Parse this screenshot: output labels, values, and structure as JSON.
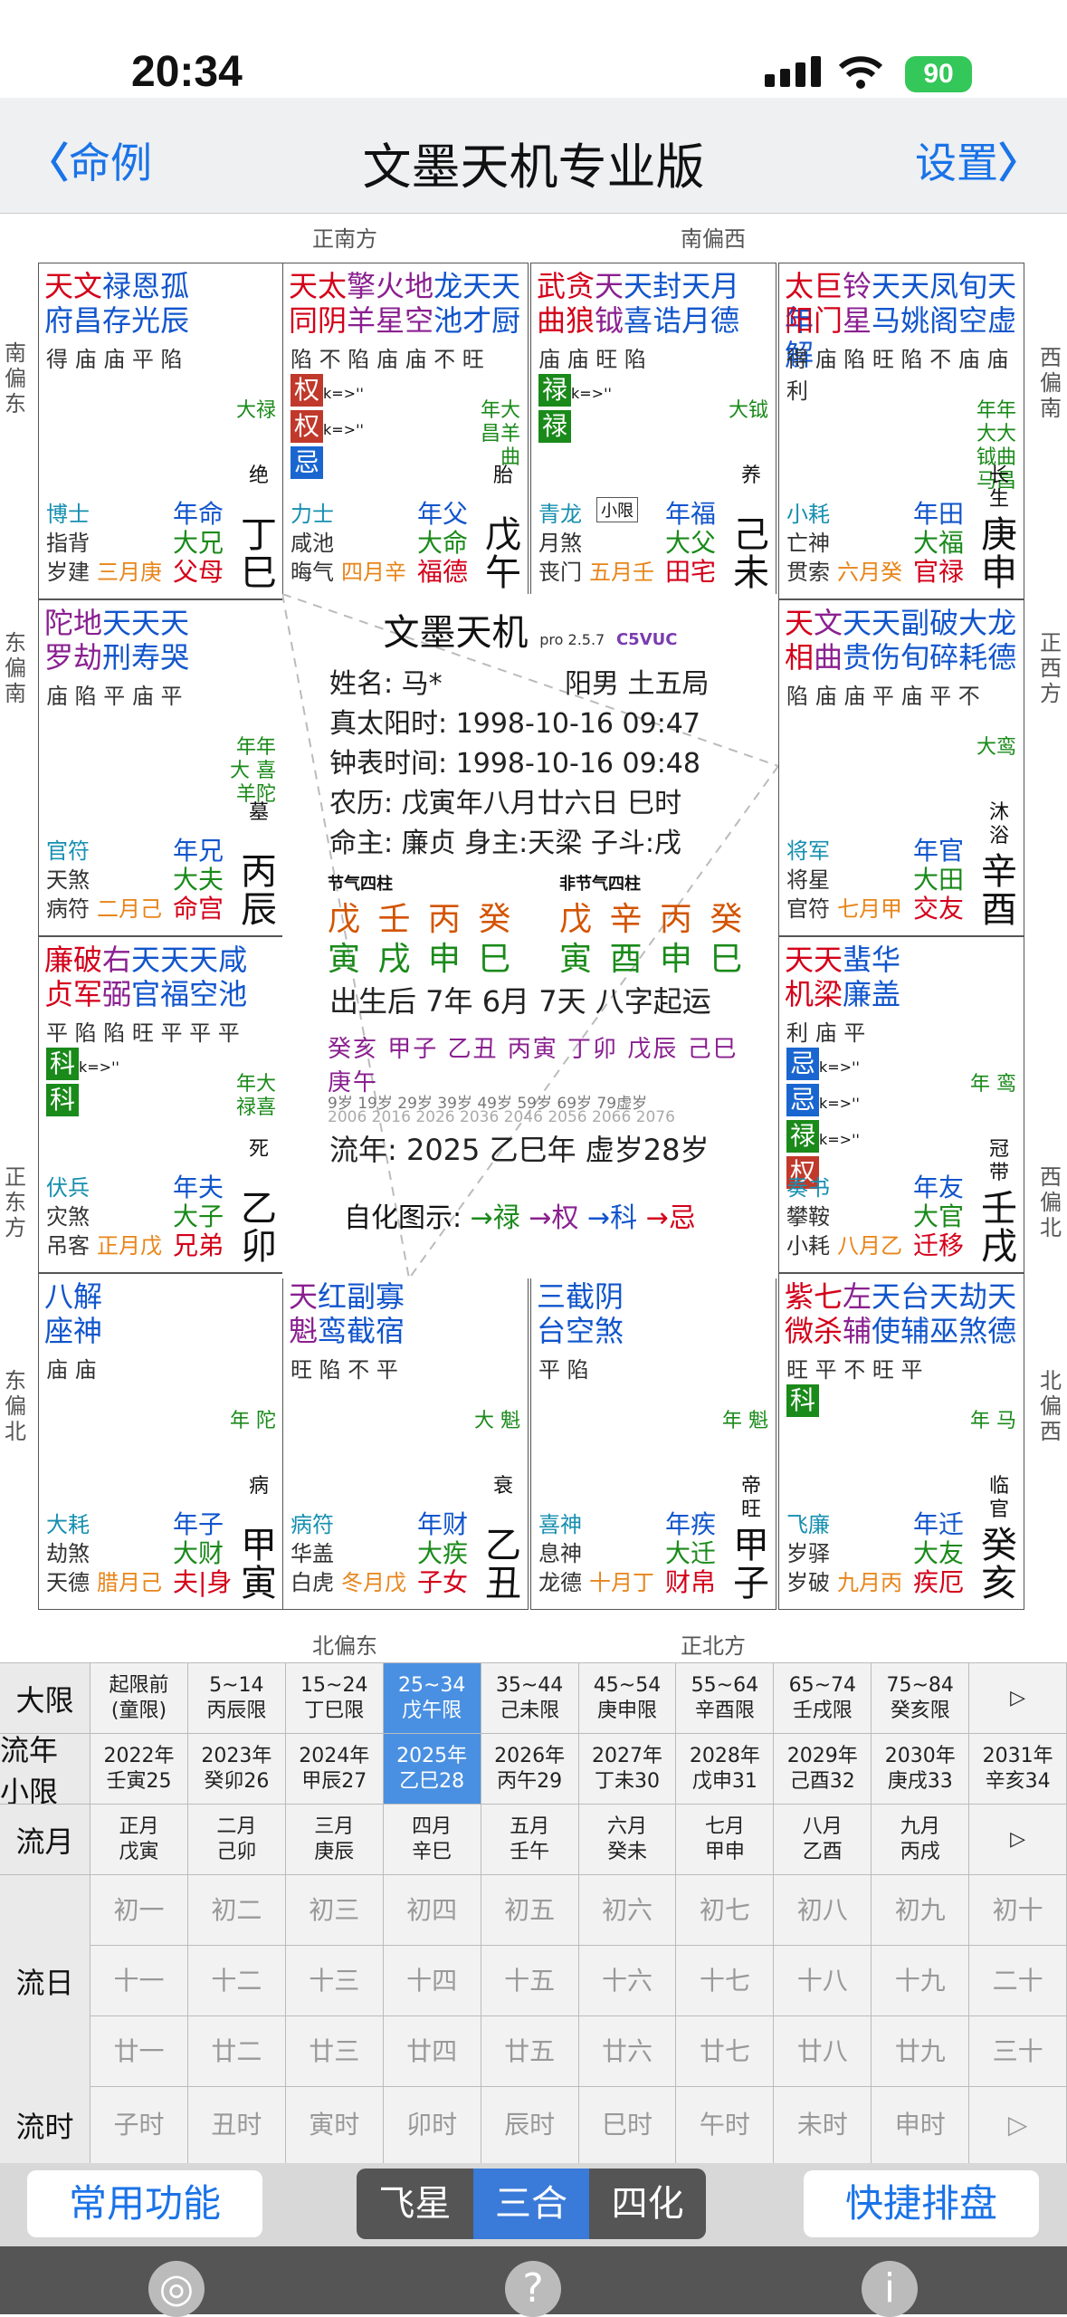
{
  "status": {
    "time": "20:34",
    "battery": "90"
  },
  "nav": {
    "back": "命例",
    "title": "文墨天机专业版",
    "settings": "设置"
  },
  "chart": {
    "dirs": {
      "top_left": "正南方",
      "top_right": "南偏西",
      "bottom_left": "北偏东",
      "bottom_right": "正北方",
      "l1": "南偏东",
      "l2": "东偏南",
      "l3": "正东方",
      "l4": "东偏北",
      "r1": "西偏南",
      "r2": "正西方",
      "r3": "西偏北",
      "r4": "北偏西"
    },
    "cells": [
      {
        "id": "si",
        "stars": [
          [
            "天",
            "red"
          ],
          [
            "文",
            "red"
          ],
          [
            "禄",
            "blue"
          ],
          [
            "恩",
            "blue"
          ],
          [
            "孤",
            "blue"
          ]
        ],
        "stars2": [
          [
            "府",
            "blue"
          ],
          [
            "昌",
            "blue"
          ],
          [
            "存",
            "blue"
          ],
          [
            "光",
            "blue"
          ],
          [
            "辰",
            "blue"
          ]
        ],
        "bright": "得 庙 庙 平 陷",
        "xiao": "大禄",
        "god1": "博士",
        "god2": "指背",
        "god3": "岁建",
        "month": "三月庚",
        "palace1": "年命",
        "palace2": "大兄",
        "palace3": "父母",
        "stage": "绝",
        "gan": "丁",
        "zhi": "巳"
      },
      {
        "id": "wu",
        "stars": [
          [
            "天",
            "red"
          ],
          [
            "太",
            "red"
          ],
          [
            "擎",
            "purple"
          ],
          [
            "火",
            "purple"
          ],
          [
            "地",
            "purple"
          ],
          [
            "龙",
            "blue"
          ],
          [
            "天",
            "blue"
          ],
          [
            "天",
            "blue"
          ]
        ],
        "stars2": [
          [
            "同",
            "red"
          ],
          [
            "阴",
            "red"
          ],
          [
            "羊",
            "purple"
          ],
          [
            "星",
            "purple"
          ],
          [
            "空",
            "purple"
          ],
          [
            "池",
            "blue"
          ],
          [
            "才",
            "blue"
          ],
          [
            "厨",
            "blue"
          ]
        ],
        "bright": "陷 不 陷 庙 庙 不 旺",
        "hua": [
          "权",
          "权",
          "忌"
        ],
        "xiao": "年大 昌羊曲",
        "god1": "力士",
        "god2": "咸池",
        "god3": "晦气",
        "month": "四月辛",
        "palace1": "年父",
        "palace2": "大命",
        "palace3": "福德",
        "stage": "胎",
        "gan": "戊",
        "zhi": "午"
      },
      {
        "id": "wei",
        "stars": [
          [
            "武",
            "red"
          ],
          [
            "贪",
            "red"
          ],
          [
            "天",
            "purple"
          ],
          [
            "天",
            "blue"
          ],
          [
            "封",
            "blue"
          ],
          [
            "天",
            "blue"
          ],
          [
            "月",
            "blue"
          ]
        ],
        "stars2": [
          [
            "曲",
            "red"
          ],
          [
            "狼",
            "red"
          ],
          [
            "钺",
            "purple"
          ],
          [
            "喜",
            "blue"
          ],
          [
            "诰",
            "blue"
          ],
          [
            "月",
            "blue"
          ],
          [
            "德",
            "blue"
          ]
        ],
        "bright": "庙 庙 旺 陷",
        "hua": [
          "禄",
          "禄"
        ],
        "xiao": "大钺",
        "god1": "青龙",
        "god2": "月煞",
        "god3": "丧门",
        "month": "五月壬",
        "palace1": "年福",
        "palace2": "大父",
        "palace3": "田宅",
        "stage": "养",
        "gan": "己",
        "zhi": "未",
        "tag": "小限"
      },
      {
        "id": "shen",
        "stars": [
          [
            "太",
            "red"
          ],
          [
            "巨",
            "red"
          ],
          [
            "铃",
            "purple"
          ],
          [
            "天",
            "blue"
          ],
          [
            "天",
            "blue"
          ],
          [
            "凤",
            "blue"
          ],
          [
            "旬",
            "blue"
          ],
          [
            "天",
            "blue"
          ],
          [
            "年",
            "blue"
          ]
        ],
        "stars2": [
          [
            "阳",
            "red"
          ],
          [
            "门",
            "red"
          ],
          [
            "星",
            "purple"
          ],
          [
            "马",
            "blue"
          ],
          [
            "姚",
            "blue"
          ],
          [
            "阁",
            "blue"
          ],
          [
            "空",
            "blue"
          ],
          [
            "虚",
            "blue"
          ],
          [
            "解",
            "blue"
          ]
        ],
        "bright": "得 庙 陷 旺 陷 不 庙 庙 利",
        "xiao": "年年大大 钺曲马昌",
        "god1": "小耗",
        "god2": "亡神",
        "god3": "贯索",
        "month": "六月癸",
        "palace1": "年田",
        "palace2": "大福",
        "palace3": "官禄",
        "stage": "长生",
        "gan": "庚",
        "zhi": "申"
      },
      {
        "id": "chen",
        "stars": [
          [
            "陀",
            "purple"
          ],
          [
            "地",
            "purple"
          ],
          [
            "天",
            "blue"
          ],
          [
            "天",
            "blue"
          ],
          [
            "天",
            "blue"
          ]
        ],
        "stars2": [
          [
            "罗",
            "purple"
          ],
          [
            "劫",
            "purple"
          ],
          [
            "刑",
            "blue"
          ],
          [
            "寿",
            "blue"
          ],
          [
            "哭",
            "blue"
          ]
        ],
        "bright": "庙 陷 平 庙 平",
        "xiao": "年年大 喜羊陀",
        "god1": "官符",
        "god2": "天煞",
        "god3": "病符",
        "month": "二月己",
        "palace1": "年兄",
        "palace2": "大夫",
        "palace3": "命宫",
        "stage": "墓",
        "gan": "丙",
        "zhi": "辰"
      },
      {
        "id": "you",
        "stars": [
          [
            "天",
            "red"
          ],
          [
            "文",
            "purple"
          ],
          [
            "天",
            "blue"
          ],
          [
            "天",
            "blue"
          ],
          [
            "副",
            "blue"
          ],
          [
            "破",
            "blue"
          ],
          [
            "大",
            "blue"
          ],
          [
            "龙",
            "blue"
          ]
        ],
        "stars2": [
          [
            "相",
            "red"
          ],
          [
            "曲",
            "purple"
          ],
          [
            "贵",
            "blue"
          ],
          [
            "伤",
            "blue"
          ],
          [
            "旬",
            "blue"
          ],
          [
            "碎",
            "blue"
          ],
          [
            "耗",
            "blue"
          ],
          [
            "德",
            "blue"
          ]
        ],
        "bright": "陷 庙 庙 平 庙 平 不",
        "xiao": "大鸾",
        "god1": "将军",
        "god2": "将星",
        "god3": "官符",
        "month": "七月甲",
        "palace1": "年官",
        "palace2": "大田",
        "palace3": "交友",
        "stage": "沐浴",
        "gan": "辛",
        "zhi": "酉"
      },
      {
        "id": "mao",
        "stars": [
          [
            "廉",
            "red"
          ],
          [
            "破",
            "red"
          ],
          [
            "右",
            "purple"
          ],
          [
            "天",
            "blue"
          ],
          [
            "天",
            "blue"
          ],
          [
            "天",
            "blue"
          ],
          [
            "咸",
            "blue"
          ]
        ],
        "stars2": [
          [
            "贞",
            "red"
          ],
          [
            "军",
            "red"
          ],
          [
            "弼",
            "purple"
          ],
          [
            "官",
            "blue"
          ],
          [
            "福",
            "blue"
          ],
          [
            "空",
            "blue"
          ],
          [
            "池",
            "blue"
          ]
        ],
        "bright": "平 陷 陷 旺 平 平 平",
        "hua": [
          "科",
          "科"
        ],
        "xiao": "年大 禄喜",
        "god1": "伏兵",
        "god2": "灾煞",
        "god3": "吊客",
        "month": "正月戊",
        "palace1": "年夫",
        "palace2": "大子",
        "palace3": "兄弟",
        "stage": "死",
        "gan": "乙",
        "zhi": "卯"
      },
      {
        "id": "xu",
        "stars": [
          [
            "天",
            "red"
          ],
          [
            "天",
            "red"
          ],
          [
            "蜚",
            "blue"
          ],
          [
            "华",
            "blue"
          ]
        ],
        "stars2": [
          [
            "机",
            "red"
          ],
          [
            "梁",
            "red"
          ],
          [
            "廉",
            "blue"
          ],
          [
            "盖",
            "blue"
          ]
        ],
        "bright": "利 庙 平",
        "hua": [
          "忌",
          "忌",
          "禄",
          "权"
        ],
        "xiao": "年 鸾",
        "god1": "奏书",
        "god2": "攀鞍",
        "god3": "小耗",
        "month": "八月乙",
        "palace1": "年友",
        "palace2": "大官",
        "palace3": "迁移",
        "stage": "冠带",
        "gan": "壬",
        "zhi": "戌"
      },
      {
        "id": "yin",
        "stars": [
          [
            "八",
            "blue"
          ],
          [
            "解",
            "blue"
          ]
        ],
        "stars2": [
          [
            "座",
            "blue"
          ],
          [
            "神",
            "blue"
          ]
        ],
        "bright": "庙 庙",
        "xiao": "年 陀",
        "god1": "大耗",
        "god2": "劫煞",
        "god3": "天德",
        "month": "腊月己",
        "palace1": "年子",
        "palace2": "大财",
        "palace3": "夫|身",
        "stage": "病",
        "gan": "甲",
        "zhi": "寅"
      },
      {
        "id": "chou",
        "stars": [
          [
            "天",
            "purple"
          ],
          [
            "红",
            "blue"
          ],
          [
            "副",
            "blue"
          ],
          [
            "寡",
            "blue"
          ]
        ],
        "stars2": [
          [
            "魁",
            "purple"
          ],
          [
            "鸾",
            "blue"
          ],
          [
            "截",
            "blue"
          ],
          [
            "宿",
            "blue"
          ]
        ],
        "bright": "旺 陷 不 平",
        "xiao": "大 魁",
        "god1": "病符",
        "god2": "华盖",
        "god3": "白虎",
        "month": "冬月戊",
        "palace1": "年财",
        "palace2": "大疾",
        "palace3": "子女",
        "stage": "衰",
        "gan": "乙",
        "zhi": "丑"
      },
      {
        "id": "zi",
        "stars": [
          [
            "三",
            "blue"
          ],
          [
            "截",
            "blue"
          ],
          [
            "阴",
            "blue"
          ]
        ],
        "stars2": [
          [
            "台",
            "blue"
          ],
          [
            "空",
            "blue"
          ],
          [
            "煞",
            "blue"
          ]
        ],
        "bright": "平 陷",
        "xiao": "年 魁",
        "god1": "喜神",
        "god2": "息神",
        "god3": "龙德",
        "month": "十月丁",
        "palace1": "年疾",
        "palace2": "大迁",
        "palace3": "财帛",
        "stage": "帝旺",
        "gan": "甲",
        "zhi": "子"
      },
      {
        "id": "hai",
        "stars": [
          [
            "紫",
            "red"
          ],
          [
            "七",
            "red"
          ],
          [
            "左",
            "purple"
          ],
          [
            "天",
            "blue"
          ],
          [
            "台",
            "blue"
          ],
          [
            "天",
            "blue"
          ],
          [
            "劫",
            "blue"
          ],
          [
            "天",
            "blue"
          ]
        ],
        "stars2": [
          [
            "微",
            "red"
          ],
          [
            "杀",
            "red"
          ],
          [
            "辅",
            "purple"
          ],
          [
            "使",
            "blue"
          ],
          [
            "辅",
            "blue"
          ],
          [
            "巫",
            "blue"
          ],
          [
            "煞",
            "blue"
          ],
          [
            "德",
            "blue"
          ]
        ],
        "bright": "旺 平 不 旺 平",
        "hua": [
          "科"
        ],
        "xiao": "年 马",
        "god1": "飞廉",
        "god2": "岁驿",
        "god3": "岁破",
        "month": "九月丙",
        "palace1": "年迁",
        "palace2": "大友",
        "palace3": "疾厄",
        "stage": "临官",
        "gan": "癸",
        "zhi": "亥"
      }
    ],
    "center": {
      "title": "文墨天机",
      "ver": "pro 2.5.7",
      "code": "C5VUC",
      "name": "姓名: 马*",
      "gender": "阳男 土五局",
      "solar": "真太阳时: 1998-10-16  09:47",
      "clock": "钟表时间: 1998-10-16  09:48",
      "lunar": "农历: 戊寅年八月廿六日 巳时",
      "ming": "命主: 廉贞 身主:天梁  子斗:戌",
      "jie": "节气四柱",
      "fjie": "非节气四柱",
      "p1a": "戊 壬 丙 癸",
      "p1b": "寅 戌 申 巳",
      "p2a": "戊 辛 丙 癸",
      "p2b": "寅 酉 申 巳",
      "yun": "出生后 7年 6月 7天 八字起运",
      "dayun": "癸亥 甲子 乙丑 丙寅 丁卯 戊辰 己巳 庚午",
      "ages": "9岁 19岁 29岁 39岁 49岁 59岁 69岁 79虚岁",
      "years": "2006 2016 2026 2036 2046 2056 2066 2076",
      "liunian": "流年: 2025 乙巳年   虚岁28岁",
      "zihua": "自化图示:",
      "zh1": "→禄",
      "zh2": "→权",
      "zh3": "→科",
      "zh4": "→忌"
    }
  },
  "table": {
    "daxian_label": "大限",
    "daxian": [
      "起限前\n(童限)",
      "5~14\n丙辰限",
      "15~24\n丁巳限",
      "25~34\n戊午限",
      "35~44\n己未限",
      "45~54\n庚申限",
      "55~64\n辛酉限",
      "65~74\n壬戌限",
      "75~84\n癸亥限",
      "▷"
    ],
    "liunian_label": "流年\n小限",
    "liunian": [
      "2022年\n壬寅25",
      "2023年\n癸卯26",
      "2024年\n甲辰27",
      "2025年\n乙巳28",
      "2026年\n丙午29",
      "2027年\n丁未30",
      "2028年\n戊申31",
      "2029年\n己酉32",
      "2030年\n庚戌33",
      "2031年\n辛亥34"
    ],
    "liuyue_label": "流月",
    "liuyue": [
      "正月\n戊寅",
      "二月\n己卯",
      "三月\n庚辰",
      "四月\n辛巳",
      "五月\n壬午",
      "六月\n癸未",
      "七月\n甲申",
      "八月\n乙酉",
      "九月\n丙戌",
      "▷"
    ],
    "liuri_label": "流日",
    "liuri1": [
      "初一",
      "初二",
      "初三",
      "初四",
      "初五",
      "初六",
      "初七",
      "初八",
      "初九",
      "初十"
    ],
    "liuri2": [
      "十一",
      "十二",
      "十三",
      "十四",
      "十五",
      "十六",
      "十七",
      "十八",
      "十九",
      "二十"
    ],
    "liuri3": [
      "廿一",
      "廿二",
      "廿三",
      "廿四",
      "廿五",
      "廿六",
      "廿七",
      "廿八",
      "廿九",
      "三十"
    ],
    "liushi_label": "流时",
    "liushi": [
      "子时",
      "丑时",
      "寅时",
      "卯时",
      "辰时",
      "巳时",
      "午时",
      "未时",
      "申时",
      "▷"
    ]
  },
  "bottom": {
    "common": "常用功能",
    "seg": [
      "飞星",
      "三合",
      "四化"
    ],
    "quick": "快捷排盘"
  },
  "colors": {
    "accent": "#1a73e8",
    "selected": "#4a90e2"
  }
}
